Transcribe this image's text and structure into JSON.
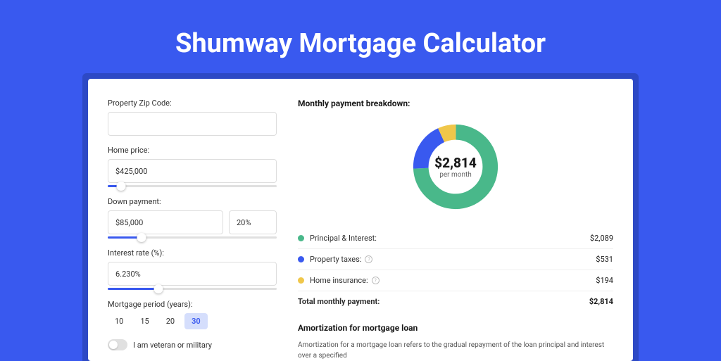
{
  "title": "Shumway Mortgage Calculator",
  "form": {
    "zip_label": "Property Zip Code:",
    "zip_value": "",
    "home_price_label": "Home price:",
    "home_price_value": "$425,000",
    "home_price_slider_pct": 8,
    "down_payment_label": "Down payment:",
    "down_payment_value": "$85,000",
    "down_payment_pct_value": "20%",
    "down_payment_slider_pct": 20,
    "interest_label": "Interest rate (%):",
    "interest_value": "6.230%",
    "interest_slider_pct": 30,
    "period_label": "Mortgage period (years):",
    "period_options": [
      "10",
      "15",
      "20",
      "30"
    ],
    "period_selected": "30",
    "veteran_label": "I am veteran or military"
  },
  "breakdown": {
    "title": "Monthly payment breakdown:",
    "center_amount": "$2,814",
    "center_sub": "per month",
    "items": [
      {
        "key": "pi",
        "label": "Principal & Interest:",
        "value": "$2,089",
        "color": "#49b88a",
        "info": false
      },
      {
        "key": "tax",
        "label": "Property taxes:",
        "value": "$531",
        "color": "#3959ef",
        "info": true
      },
      {
        "key": "ins",
        "label": "Home insurance:",
        "value": "$194",
        "color": "#f0c74a",
        "info": true
      }
    ],
    "total_label": "Total monthly payment:",
    "total_value": "$2,814"
  },
  "amort": {
    "title": "Amortization for mortgage loan",
    "text": "Amortization for a mortgage loan refers to the gradual repayment of the loan principal and interest over a specified"
  },
  "chart_data": {
    "type": "pie",
    "title": "Monthly payment breakdown",
    "series": [
      {
        "name": "Principal & Interest",
        "value": 2089,
        "color": "#49b88a"
      },
      {
        "name": "Property taxes",
        "value": 531,
        "color": "#3959ef"
      },
      {
        "name": "Home insurance",
        "value": 194,
        "color": "#f0c74a"
      }
    ],
    "total": 2814,
    "center_label": "$2,814 per month"
  }
}
